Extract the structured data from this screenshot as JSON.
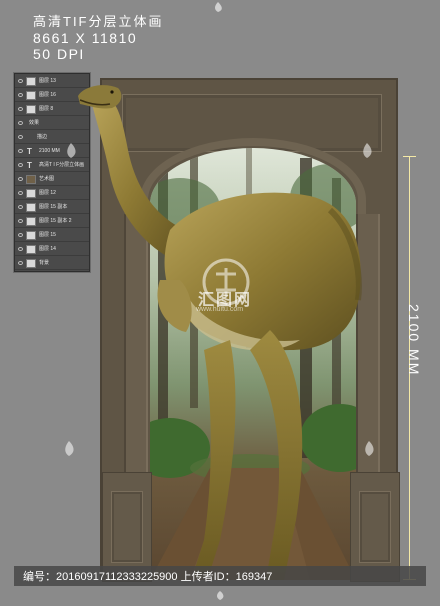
{
  "header": {
    "title": "高清TIF分层立体画",
    "dimensions": "8661 X 11810",
    "resolution": "50 DPI"
  },
  "layers_panel": {
    "rows": [
      {
        "label": "图层 13",
        "type": "image"
      },
      {
        "label": "图层 16",
        "type": "image"
      },
      {
        "label": "图层 8",
        "type": "image"
      },
      {
        "label": "效果",
        "type": "fx"
      },
      {
        "label": "描边",
        "type": "fx-sub"
      },
      {
        "label": "2100 MM",
        "type": "text"
      },
      {
        "label": "高清T I F分层立体画",
        "type": "text"
      },
      {
        "label": "艺术图",
        "type": "image"
      },
      {
        "label": "图层 12",
        "type": "image"
      },
      {
        "label": "图层 15 副本",
        "type": "image"
      },
      {
        "label": "图层 15 副本 2",
        "type": "image"
      },
      {
        "label": "图层 15",
        "type": "image"
      },
      {
        "label": "图层 14",
        "type": "image"
      },
      {
        "label": "背景",
        "type": "image"
      }
    ]
  },
  "dimension_marker": {
    "label": "2100 MM"
  },
  "footer": {
    "id_label": "编号：",
    "id_value": "20160917112333225900",
    "uploader_label": " 上传者ID：",
    "uploader_value": "169347"
  },
  "watermark": {
    "text": "汇图网",
    "url_text": "www.huitu.com"
  },
  "colors": {
    "background": "#8a8a8a",
    "frame": "#5f5545",
    "dimension_line": "#f4e9a6",
    "dinosaur": "#a28c3a"
  }
}
